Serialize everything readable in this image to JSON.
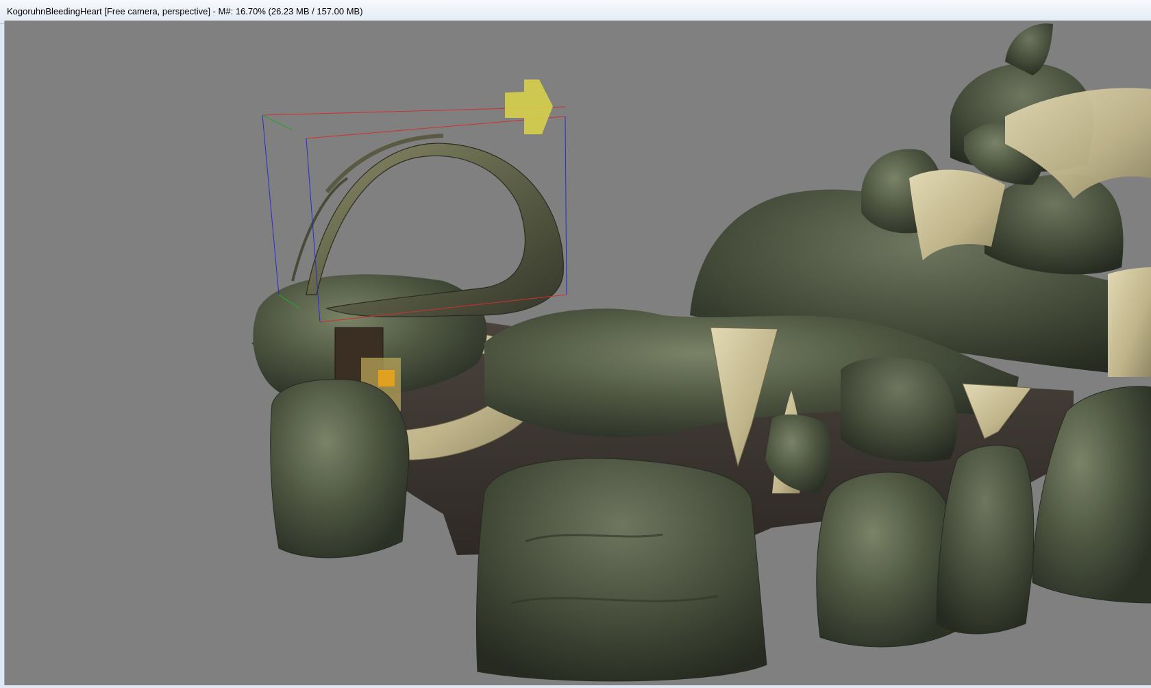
{
  "window": {
    "title": "KogoruhnBleedingHeart [Free camera, perspective] - M#: 16.70% (26.23 MB / 157.00 MB)"
  },
  "viewport": {
    "background_color": "#808080",
    "rock_color": "#4a5240",
    "bone_color": "#c8bd92",
    "ground_color": "#3a3430",
    "gizmo_axis_colors": {
      "x": "#d03030",
      "y": "#2aa02a",
      "z": "#2a2ad0"
    },
    "move_arrow_color": "#d6cf4a",
    "selected_handle_color": "#e0a020"
  }
}
